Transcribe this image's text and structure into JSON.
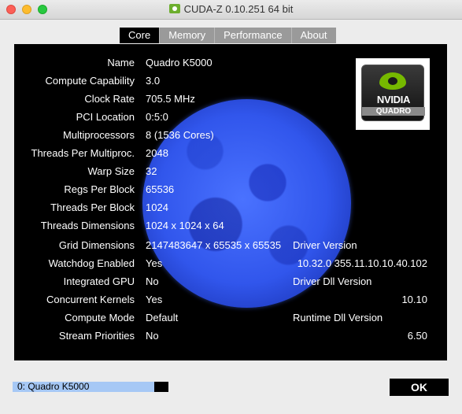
{
  "window": {
    "title": "CUDA-Z 0.10.251 64 bit"
  },
  "tabs": [
    {
      "label": "Core",
      "active": true
    },
    {
      "label": "Memory",
      "active": false
    },
    {
      "label": "Performance",
      "active": false
    },
    {
      "label": "About",
      "active": false
    }
  ],
  "logo": {
    "brand": "NVIDIA",
    "sub": "QUADRO"
  },
  "core": [
    {
      "label": "Name",
      "value": "Quadro K5000"
    },
    {
      "label": "Compute Capability",
      "value": "3.0"
    },
    {
      "label": "Clock Rate",
      "value": "705.5 MHz"
    },
    {
      "label": "PCI Location",
      "value": "0:5:0"
    },
    {
      "label": "Multiprocessors",
      "value": "8 (1536 Cores)"
    },
    {
      "label": "Threads Per Multiproc.",
      "value": "2048"
    },
    {
      "label": "Warp Size",
      "value": "32"
    },
    {
      "label": "Regs Per Block",
      "value": "65536"
    },
    {
      "label": "Threads Per Block",
      "value": "1024"
    },
    {
      "label": "Threads Dimensions",
      "value": "1024 x 1024 x 64"
    },
    {
      "label": "Grid Dimensions",
      "value": "2147483647 x 65535 x 65535"
    },
    {
      "label": "Watchdog Enabled",
      "value": "Yes"
    },
    {
      "label": "Integrated GPU",
      "value": "No"
    },
    {
      "label": "Concurrent Kernels",
      "value": "Yes"
    },
    {
      "label": "Compute Mode",
      "value": "Default"
    },
    {
      "label": "Stream Priorities",
      "value": "No"
    }
  ],
  "versions": {
    "driver_label": "Driver Version",
    "driver_value": "10.32.0 355.11.10.10.40.102",
    "dll_label": "Driver Dll Version",
    "dll_value": "10.10",
    "runtime_label": "Runtime Dll Version",
    "runtime_value": "6.50"
  },
  "device_select": {
    "value": "0: Quadro K5000"
  },
  "ok_button": {
    "label": "OK"
  }
}
